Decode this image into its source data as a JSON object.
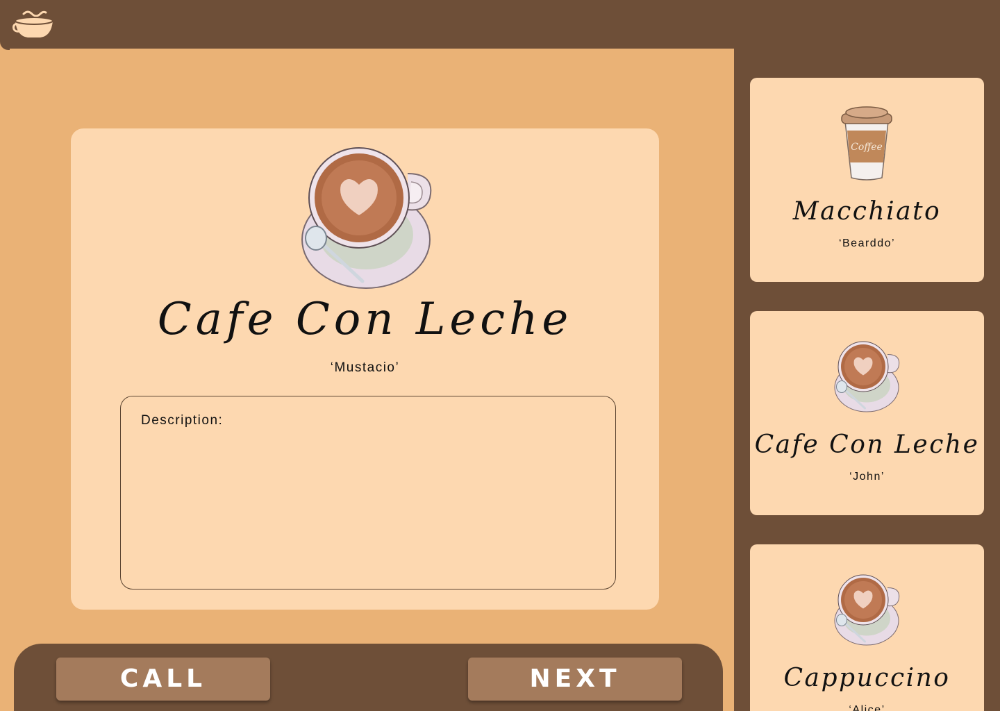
{
  "app": {
    "logo_icon": "coffee-cup-logo-icon"
  },
  "detail": {
    "image_icon": "latte-cup-icon",
    "title": "Cafe Con Leche",
    "customer": "‘Mustacio’",
    "description_label": "Description:",
    "description_value": ""
  },
  "actions": {
    "call_label": "CALL",
    "next_label": "NEXT"
  },
  "queue": [
    {
      "icon": "takeaway-coffee-cup-icon",
      "cup_text": "Coffee",
      "title": "Macchiato",
      "customer": "‘Bearddo’"
    },
    {
      "icon": "latte-cup-icon",
      "title": "Cafe Con Leche",
      "customer": "‘John’"
    },
    {
      "icon": "latte-cup-icon",
      "title": "Cappuccino",
      "customer": "‘Alice’"
    }
  ],
  "colors": {
    "dark_brown": "#6e4f38",
    "caramel": "#eab276",
    "cream": "#fdd8b0",
    "button": "#a47b5c"
  }
}
